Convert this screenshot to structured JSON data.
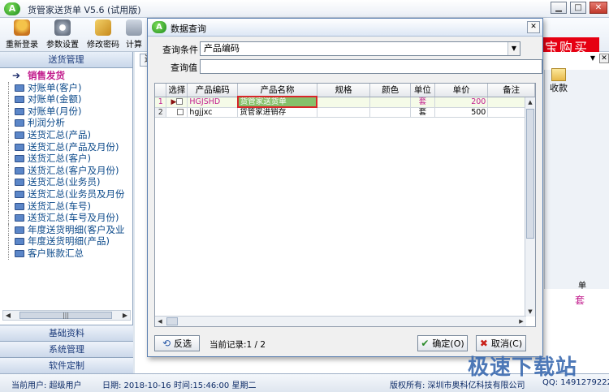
{
  "window": {
    "title": "货管家送货单 V5.6 (试用版)"
  },
  "toolbar": {
    "items": [
      "重新登录",
      "参数设置",
      "修改密码",
      "计算"
    ],
    "ad": "宝购买"
  },
  "leftnav": {
    "header": "送货管理",
    "items": [
      "销售发货",
      "对账单(客户)",
      "对账单(金额)",
      "对账单(月份)",
      "利润分析",
      "送货汇总(产品)",
      "送货汇总(产品及月份)",
      "送货汇总(客户)",
      "送货汇总(客户及月份)",
      "送货汇总(业务员)",
      "送货汇总(业务员及月份",
      "送货汇总(车号)",
      "送货汇总(车号及月份)",
      "年度送货明细(客户及业",
      "年度送货明细(产品)",
      "客户账款汇总"
    ],
    "footer": [
      "基础资料",
      "系统管理",
      "软件定制"
    ]
  },
  "background": {
    "tab": "送",
    "receive": "收款",
    "unit_header": "单",
    "unit_value": "套"
  },
  "dialog": {
    "title": "数据查询",
    "query_condition_label": "查询条件",
    "query_condition_value": "产品编码",
    "query_value_label": "查询值",
    "query_value": "",
    "columns": [
      "选择",
      "产品编码",
      "产品名称",
      "规格",
      "颜色",
      "单位",
      "单价",
      "备注"
    ],
    "rows": [
      {
        "no": "1",
        "code": "HGJSHD",
        "name": "货管家送货单",
        "spec": "",
        "color": "",
        "unit": "套",
        "price": "200",
        "note": ""
      },
      {
        "no": "2",
        "code": "hgjjxc",
        "name": "货管家进销存",
        "spec": "",
        "color": "",
        "unit": "套",
        "price": "500",
        "note": ""
      }
    ],
    "invert_label": "反选",
    "record_text": "当前记录:1 / 2",
    "ok_label": "确定(O)",
    "cancel_label": "取消(C)"
  },
  "status": {
    "user": "当前用户: 超级用户",
    "date": "日期: 2018-10-16",
    "time": "时间:15:46:00 星期二",
    "copyright": "版权所有: 深圳市奥科亿科技有限公司",
    "qq": "QQ: 1491279222"
  },
  "watermark": {
    "text": "极速下载站"
  },
  "colors": {
    "accent": "#c21b8c",
    "selection": "#86c06a",
    "highlight_border": "#d8262a"
  }
}
